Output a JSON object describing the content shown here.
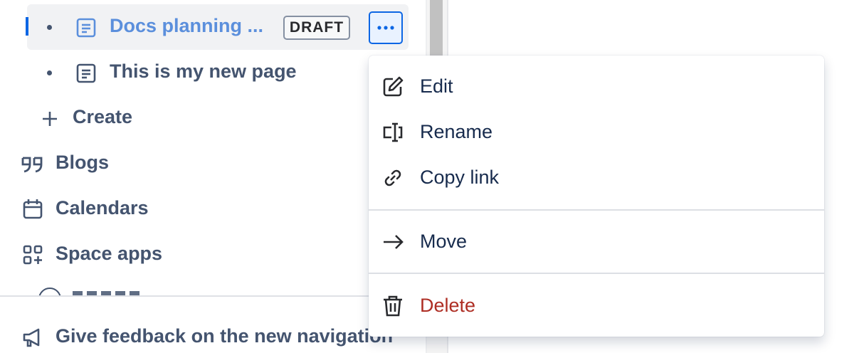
{
  "sidebar": {
    "pages": [
      {
        "title": "Docs planning ...",
        "badge": "DRAFT"
      },
      {
        "title": "This is my new page"
      }
    ],
    "create_label": "Create",
    "nav_items": [
      {
        "label": "Blogs",
        "icon": "quote-icon"
      },
      {
        "label": "Calendars",
        "icon": "calendar-icon"
      },
      {
        "label": "Space apps",
        "icon": "apps-add-icon"
      }
    ],
    "feedback_label": "Give feedback on the new navigation"
  },
  "context_menu": {
    "items": [
      {
        "label": "Edit",
        "icon": "pencil-icon"
      },
      {
        "label": "Rename",
        "icon": "rename-icon"
      },
      {
        "label": "Copy link",
        "icon": "link-icon"
      },
      {
        "label": "Move",
        "icon": "arrow-right-icon"
      },
      {
        "label": "Delete",
        "icon": "trash-icon"
      }
    ]
  },
  "colors": {
    "accent": "#0c66e4",
    "selected_text": "#5b8fdc",
    "danger": "#ae2e24",
    "text": "#44546f"
  }
}
